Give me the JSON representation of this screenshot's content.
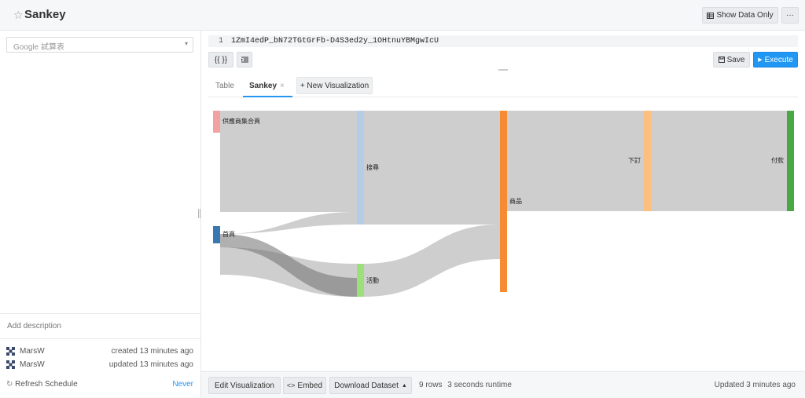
{
  "query": {
    "title": "Sankey",
    "show_data_only_label": "Show Data Only",
    "more_label": "···"
  },
  "datasource": {
    "selected": "Google 試算表"
  },
  "editor": {
    "line_number": "1",
    "code": "1ZmI4edP_bN72TGtGrFb-D4S3ed2y_1OHtnuYBMgwIcU",
    "format_label": "{{ }}",
    "save_label": "Save",
    "execute_label": "Execute"
  },
  "tabs": [
    {
      "label": "Table"
    },
    {
      "label": "Sankey",
      "close": "×"
    }
  ],
  "new_viz_label": "+ New Visualization",
  "chart_data": {
    "type": "sankey",
    "nodes": [
      {
        "name": "供應商集合頁",
        "color": "#f4a1a1"
      },
      {
        "name": "首頁",
        "color": "#3a78b3"
      },
      {
        "name": "搜尋",
        "color": "#b5cbe8"
      },
      {
        "name": "活動",
        "color": "#9be07a"
      },
      {
        "name": "商品",
        "color": "#f68b33"
      },
      {
        "name": "下訂",
        "color": "#fdbf7f"
      },
      {
        "name": "付款",
        "color": "#4aa844"
      }
    ],
    "links": [
      {
        "source": "供應商集合頁",
        "target": "供應商集合頁",
        "value": 3
      },
      {
        "source": "供應商集合頁",
        "target": "搜尋",
        "value": 10
      },
      {
        "source": "首頁",
        "target": "搜尋",
        "value": 1.5
      },
      {
        "source": "首頁",
        "target": "活動",
        "value": 2
      },
      {
        "source": "搜尋",
        "target": "商品",
        "value": 14.5
      },
      {
        "source": "活動",
        "target": "商品",
        "value": 4
      },
      {
        "source": "商品",
        "target": "下訂",
        "value": 13
      },
      {
        "source": "下訂",
        "target": "付款",
        "value": 13
      }
    ]
  },
  "sidebar": {
    "add_description": "Add description",
    "meta": [
      {
        "user": "MarsW",
        "action": "created 13 minutes ago"
      },
      {
        "user": "MarsW",
        "action": "updated 13 minutes ago"
      }
    ],
    "refresh_label": "Refresh Schedule",
    "refresh_value": "Never"
  },
  "footer": {
    "edit_viz": "Edit Visualization",
    "embed": "Embed",
    "download": "Download Dataset",
    "rows": "9 rows",
    "runtime": "3 seconds runtime",
    "updated": "Updated 3 minutes ago"
  }
}
